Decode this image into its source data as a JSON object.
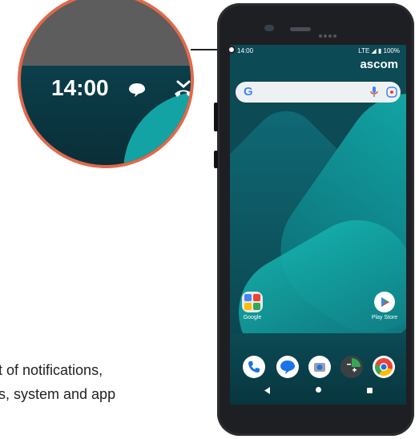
{
  "caption": {
    "line1": "t of notifications,",
    "line2": "s, system and app"
  },
  "zoom": {
    "time": "14:00"
  },
  "phone": {
    "status_time": "14:00",
    "status_right": "LTE ◢ ▮ 100%",
    "brand": "ascom",
    "search_logo": "G",
    "apps": {
      "google_label": "Google",
      "playstore_label": "Play Store"
    },
    "dock": [
      "phone-icon",
      "messages-icon",
      "camera-icon",
      "calculator-icon",
      "chrome-icon"
    ]
  },
  "colors": {
    "callout_border": "#e0694b",
    "wallpaper_teal": "#13a3a4",
    "wallpaper_dark": "#0c4a55"
  }
}
